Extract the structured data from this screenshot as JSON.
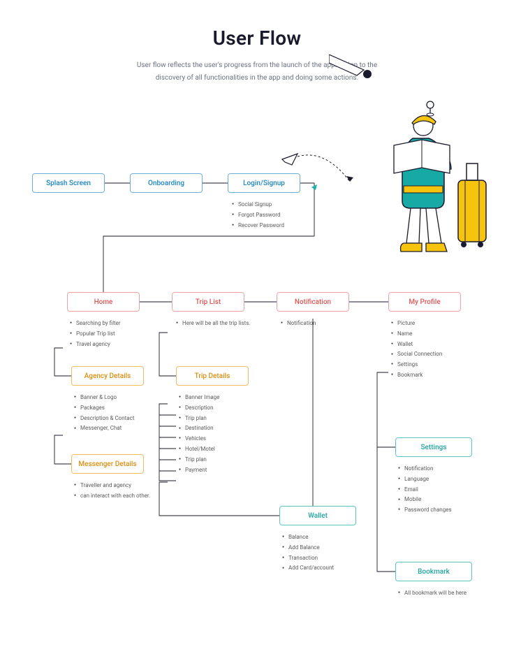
{
  "title": "User Flow",
  "description": "User flow reflects the user's progress from the launch of the application to the discovery of all functionalities in the app and doing some actions.",
  "nodes": {
    "splash": "Splash Screen",
    "onboarding": "Onboarding",
    "login": "Login/Signup",
    "home": "Home",
    "triplist": "Trip List",
    "notification": "Notification",
    "myprofile": "My Profile",
    "agencydetails": "Agency Details",
    "messengerdetails": "Messenger Details",
    "tripdetails": "Trip Details",
    "settings": "Settings",
    "wallet": "Wallet",
    "bookmark": "Bookmark"
  },
  "bullets": {
    "login": [
      "Social Signup",
      "Forgot Password",
      "Recover Password"
    ],
    "home": [
      "Searching by filter",
      "Popular Trip list",
      "Travel agency"
    ],
    "triplist": [
      "Here will be all the trip lists."
    ],
    "notification": [
      "Notification"
    ],
    "myprofile": [
      "Picture",
      "Name",
      "Wallet",
      "Social Connection",
      "Settings",
      "Bookmark"
    ],
    "agencydetails": [
      "Banner & Logo",
      "Packages",
      "Description & Contact",
      "Messenger, Chat"
    ],
    "tripdetails": [
      "Banner Image",
      "Description",
      "Trip plan",
      "Destination",
      "Vehicles",
      "Hotel/Motel",
      "Trip plan",
      "Payment"
    ],
    "messenger": [
      "Traveller and agency",
      "can interact with each other."
    ],
    "settings": [
      "Notification",
      "Language",
      "Email",
      "Mobile",
      "Password changes"
    ],
    "wallet": [
      "Balance",
      "Add Balance",
      "Transaction",
      "Add Card/account"
    ],
    "bookmark": [
      "All bookmark will be here"
    ]
  }
}
